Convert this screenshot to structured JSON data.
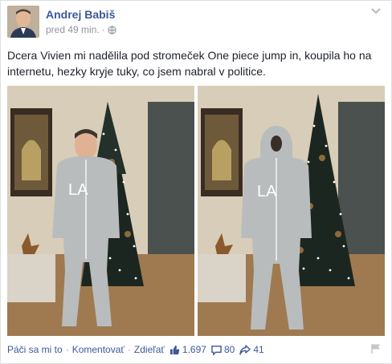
{
  "post": {
    "author": "Andrej Babiš",
    "time": "pred 49 min.",
    "time_separator": "·",
    "text": "Dcera Vivien mi nadělila pod stromeček One piece jump in, koupila ho na internetu, hezky kryje tuky, co jsem nabral v politice."
  },
  "photos": {
    "left_alt": "photo-left",
    "right_alt": "photo-right",
    "garment_logo": "LA"
  },
  "actions": {
    "like": "Páči sa mi to",
    "comment": "Komentovať",
    "share": "Zdieľať",
    "separator": "·"
  },
  "stats": {
    "likes": "1.697",
    "comments": "80",
    "shares": "41"
  },
  "icons": {
    "menu": "chevron-down-icon",
    "audience": "globe-icon",
    "like": "thumbs-up-icon",
    "comment": "comment-icon",
    "share": "share-icon",
    "report": "flag-icon"
  },
  "colors": {
    "link": "#3b5998",
    "muted": "#90949c",
    "text": "#1d2129"
  }
}
